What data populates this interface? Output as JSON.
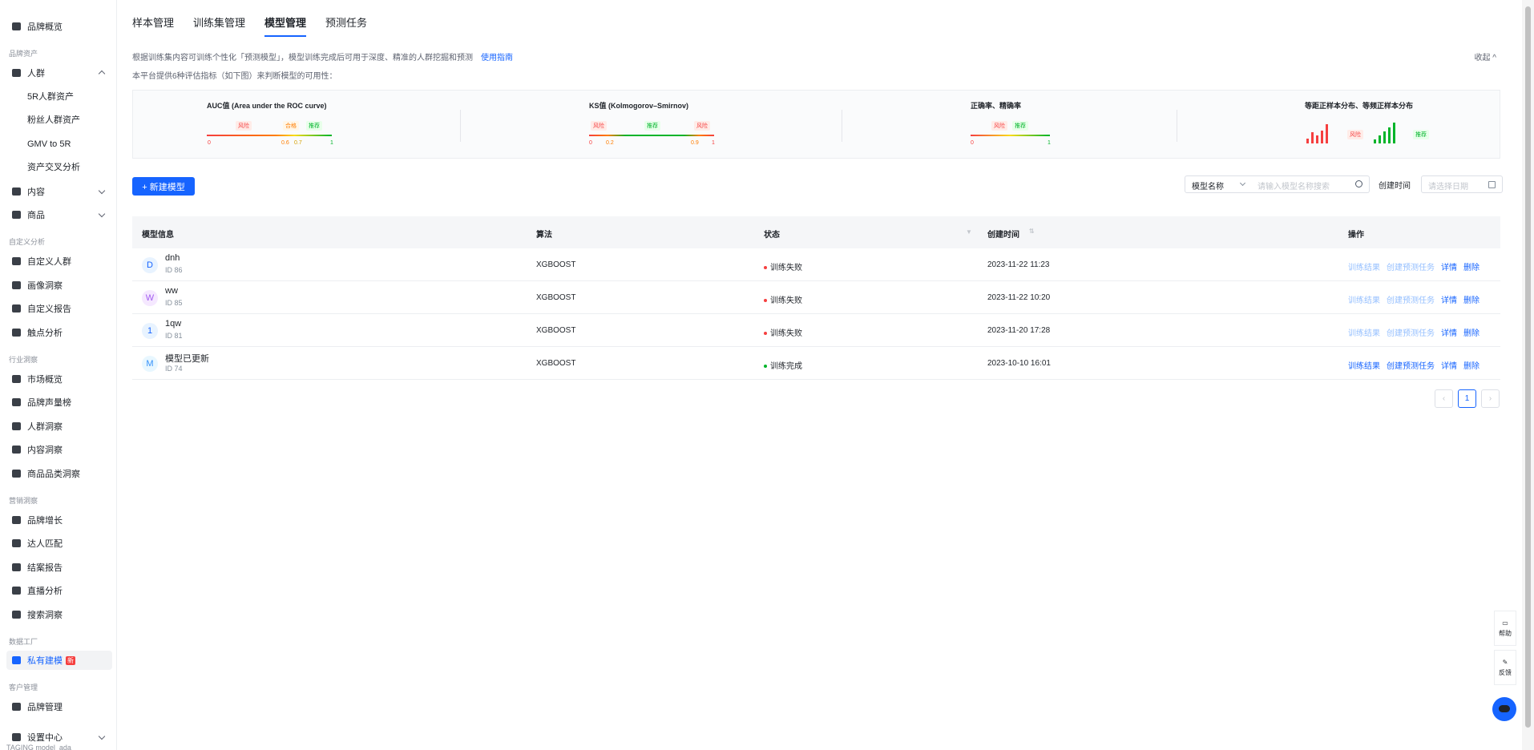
{
  "sidebar": {
    "top_item": "品牌概览",
    "groups": [
      "品牌资产",
      "自定义分析",
      "行业洞察",
      "营销洞察",
      "数据工厂",
      "客户管理"
    ],
    "people": "人群",
    "people_subs": [
      "5R人群资产",
      "粉丝人群资产",
      "GMV to 5R",
      "资产交叉分析"
    ],
    "content": "内容",
    "goods": "商品",
    "custom": [
      "自定义人群",
      "画像洞察",
      "自定义报告",
      "触点分析"
    ],
    "industry": [
      "市场概览",
      "品牌声量榜",
      "人群洞察",
      "内容洞察",
      "商品品类洞察"
    ],
    "marketing": [
      "品牌增长",
      "达人匹配",
      "结案报告",
      "直播分析",
      "搜索洞察"
    ],
    "private_model": "私有建模",
    "new_badge": "新",
    "brand_mgmt": "品牌管理",
    "settings": "设置中心",
    "footer": "TAGING model_ada"
  },
  "tabs": [
    "样本管理",
    "训练集管理",
    "模型管理",
    "预测任务"
  ],
  "description": {
    "line1": "根据训练集内容可训练个性化「预测模型」，模型训练完成后可用于深度、精准的人群挖掘和预测",
    "guide_link": "使用指南",
    "line2": "本平台提供6种评估指标（如下图）来判断模型的可用性：",
    "collapse": "收起"
  },
  "metrics": {
    "auc": {
      "title": "AUC值 (Area under the ROC curve)",
      "tags": [
        "风险",
        "合格",
        "推荐"
      ],
      "ticks": [
        "0",
        "0.6",
        "0.7",
        "1"
      ]
    },
    "ks": {
      "title": "KS值 (Kolmogorov–Smirnov)",
      "tags": [
        "风险",
        "推荐",
        "风险"
      ],
      "ticks": [
        "0",
        "0.2",
        "0.9",
        "1"
      ]
    },
    "acc": {
      "title": "正确率、精确率",
      "tags": [
        "风险",
        "推荐"
      ],
      "ticks": [
        "0",
        "1"
      ]
    },
    "dist": {
      "title": "等距正样本分布、等频正样本分布",
      "tags": [
        "风险",
        "推荐"
      ]
    }
  },
  "toolbar": {
    "new_model": "+ 新建模型",
    "search_type": "模型名称",
    "search_placeholder": "请输入模型名称搜索",
    "created_time_label": "创建时间",
    "date_placeholder": "请选择日期"
  },
  "table": {
    "headers": [
      "模型信息",
      "算法",
      "状态",
      "创建时间",
      "操作"
    ],
    "rows": [
      {
        "initial": "D",
        "name": "dnh",
        "id": "ID 86",
        "algo": "XGBOOST",
        "status": "训练失败",
        "time": "2023-11-22 11:23"
      },
      {
        "initial": "W",
        "name": "ww",
        "id": "ID 85",
        "algo": "XGBOOST",
        "status": "训练失败",
        "time": "2023-11-22 10:20"
      },
      {
        "initial": "1",
        "name": "1qw",
        "id": "ID 81",
        "algo": "XGBOOST",
        "status": "训练失败",
        "time": "2023-11-20 17:28"
      },
      {
        "initial": "M",
        "name": "模型已更新",
        "id": "ID 74",
        "algo": "XGBOOST",
        "status": "训练完成",
        "time": "2023-10-10 16:01"
      }
    ],
    "actions": [
      "训练结果",
      "创建预测任务",
      "详情",
      "删除"
    ]
  },
  "pagination": {
    "current": "1"
  },
  "side_tools": {
    "help": "帮助",
    "feedback": "反馈"
  },
  "colors": {
    "accent": "#1664ff",
    "fail": "#f53f3f",
    "success": "#00b42a"
  }
}
